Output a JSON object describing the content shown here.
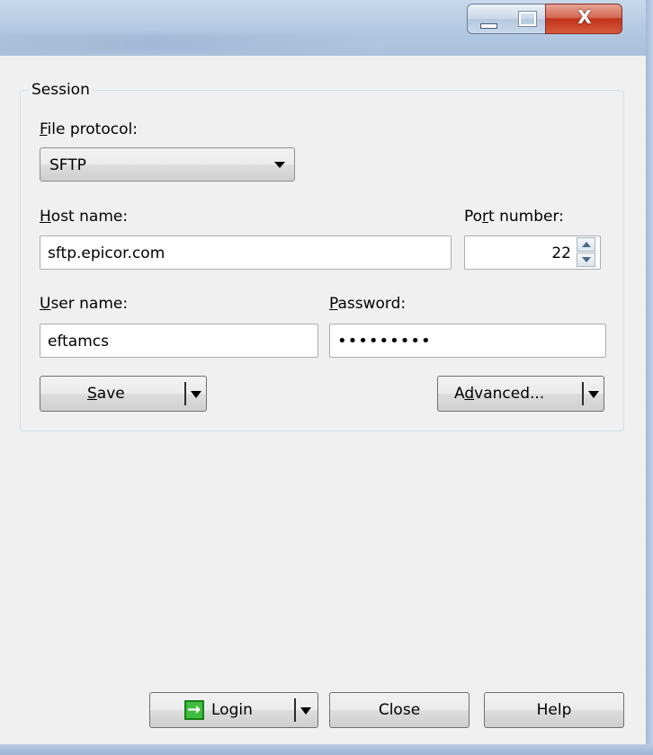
{
  "window": {
    "controls": {
      "minimize": "—",
      "maximize": "□",
      "close": "X"
    }
  },
  "session": {
    "group_label": "Session",
    "file_protocol": {
      "label": "File protocol:",
      "value": "SFTP"
    },
    "host": {
      "label": "Host name:",
      "value": "sftp.epicor.com"
    },
    "port": {
      "label": "Port number:",
      "value": "22"
    },
    "user": {
      "label": "User name:",
      "value": "eftamcs"
    },
    "password": {
      "label": "Password:",
      "value": "•••••••••"
    },
    "save_button": "Save",
    "advanced_button": "Advanced..."
  },
  "footer": {
    "login_button": "Login",
    "close_button": "Close",
    "help_button": "Help"
  },
  "icons": {
    "login": "login-icon",
    "dropdown": "chevron-down-icon",
    "spin": "spin-arrows-icon"
  }
}
